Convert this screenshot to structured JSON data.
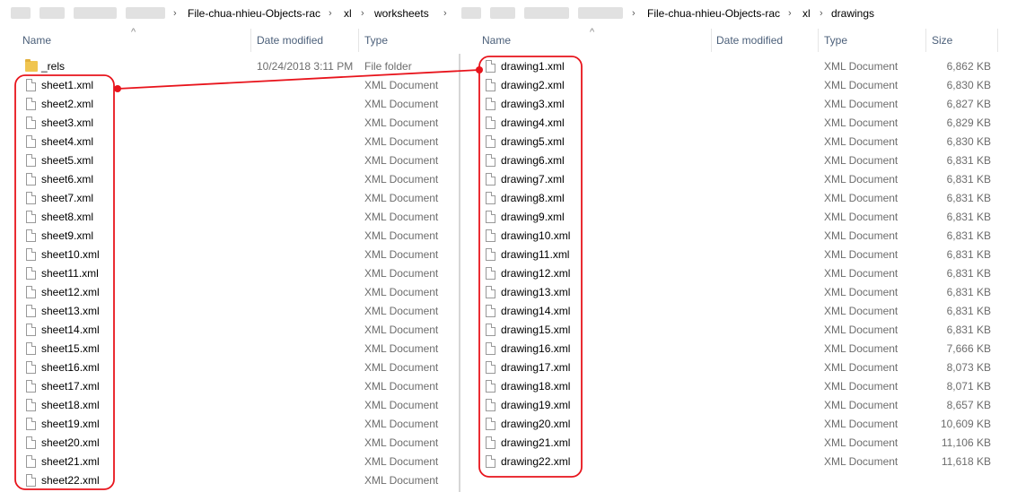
{
  "left": {
    "breadcrumb": [
      "File-chua-nhieu-Objects-rac",
      "xl",
      "worksheets"
    ],
    "columns": {
      "name": "Name",
      "date": "Date modified",
      "type": "Type"
    },
    "folder": {
      "name": "_rels",
      "date": "10/24/2018 3:11 PM",
      "type": "File folder"
    },
    "files": [
      {
        "name": "sheet1.xml",
        "type": "XML Document"
      },
      {
        "name": "sheet2.xml",
        "type": "XML Document"
      },
      {
        "name": "sheet3.xml",
        "type": "XML Document"
      },
      {
        "name": "sheet4.xml",
        "type": "XML Document"
      },
      {
        "name": "sheet5.xml",
        "type": "XML Document"
      },
      {
        "name": "sheet6.xml",
        "type": "XML Document"
      },
      {
        "name": "sheet7.xml",
        "type": "XML Document"
      },
      {
        "name": "sheet8.xml",
        "type": "XML Document"
      },
      {
        "name": "sheet9.xml",
        "type": "XML Document"
      },
      {
        "name": "sheet10.xml",
        "type": "XML Document"
      },
      {
        "name": "sheet11.xml",
        "type": "XML Document"
      },
      {
        "name": "sheet12.xml",
        "type": "XML Document"
      },
      {
        "name": "sheet13.xml",
        "type": "XML Document"
      },
      {
        "name": "sheet14.xml",
        "type": "XML Document"
      },
      {
        "name": "sheet15.xml",
        "type": "XML Document"
      },
      {
        "name": "sheet16.xml",
        "type": "XML Document"
      },
      {
        "name": "sheet17.xml",
        "type": "XML Document"
      },
      {
        "name": "sheet18.xml",
        "type": "XML Document"
      },
      {
        "name": "sheet19.xml",
        "type": "XML Document"
      },
      {
        "name": "sheet20.xml",
        "type": "XML Document"
      },
      {
        "name": "sheet21.xml",
        "type": "XML Document"
      },
      {
        "name": "sheet22.xml",
        "type": "XML Document"
      }
    ]
  },
  "right": {
    "breadcrumb": [
      "File-chua-nhieu-Objects-rac",
      "xl",
      "drawings"
    ],
    "columns": {
      "name": "Name",
      "date": "Date modified",
      "type": "Type",
      "size": "Size"
    },
    "files": [
      {
        "name": "drawing1.xml",
        "type": "XML Document",
        "size": "6,862 KB"
      },
      {
        "name": "drawing2.xml",
        "type": "XML Document",
        "size": "6,830 KB"
      },
      {
        "name": "drawing3.xml",
        "type": "XML Document",
        "size": "6,827 KB"
      },
      {
        "name": "drawing4.xml",
        "type": "XML Document",
        "size": "6,829 KB"
      },
      {
        "name": "drawing5.xml",
        "type": "XML Document",
        "size": "6,830 KB"
      },
      {
        "name": "drawing6.xml",
        "type": "XML Document",
        "size": "6,831 KB"
      },
      {
        "name": "drawing7.xml",
        "type": "XML Document",
        "size": "6,831 KB"
      },
      {
        "name": "drawing8.xml",
        "type": "XML Document",
        "size": "6,831 KB"
      },
      {
        "name": "drawing9.xml",
        "type": "XML Document",
        "size": "6,831 KB"
      },
      {
        "name": "drawing10.xml",
        "type": "XML Document",
        "size": "6,831 KB"
      },
      {
        "name": "drawing11.xml",
        "type": "XML Document",
        "size": "6,831 KB"
      },
      {
        "name": "drawing12.xml",
        "type": "XML Document",
        "size": "6,831 KB"
      },
      {
        "name": "drawing13.xml",
        "type": "XML Document",
        "size": "6,831 KB"
      },
      {
        "name": "drawing14.xml",
        "type": "XML Document",
        "size": "6,831 KB"
      },
      {
        "name": "drawing15.xml",
        "type": "XML Document",
        "size": "6,831 KB"
      },
      {
        "name": "drawing16.xml",
        "type": "XML Document",
        "size": "7,666 KB"
      },
      {
        "name": "drawing17.xml",
        "type": "XML Document",
        "size": "8,073 KB"
      },
      {
        "name": "drawing18.xml",
        "type": "XML Document",
        "size": "8,071 KB"
      },
      {
        "name": "drawing19.xml",
        "type": "XML Document",
        "size": "8,657 KB"
      },
      {
        "name": "drawing20.xml",
        "type": "XML Document",
        "size": "10,609 KB"
      },
      {
        "name": "drawing21.xml",
        "type": "XML Document",
        "size": "11,106 KB"
      },
      {
        "name": "drawing22.xml",
        "type": "XML Document",
        "size": "11,618 KB"
      }
    ]
  },
  "colors": {
    "annotation": "#e8141c",
    "header_text": "#4c607a",
    "muted_text": "#6d6d6d"
  }
}
